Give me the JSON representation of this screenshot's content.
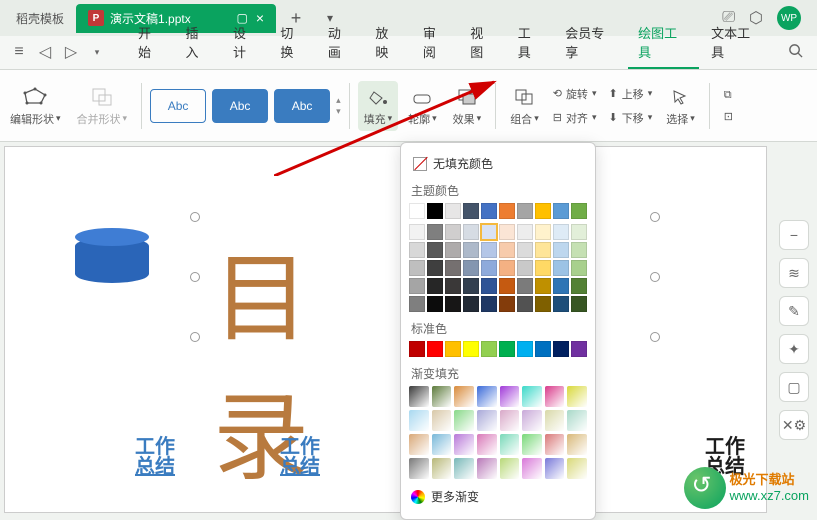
{
  "tabs": {
    "template_tab": "稻壳模板",
    "active_tab": "演示文稿1.pptx",
    "active_file_badge": "P"
  },
  "avatar_text": "WP",
  "menu": {
    "items": [
      "开始",
      "插入",
      "设计",
      "切换",
      "动画",
      "放映",
      "审阅",
      "视图",
      "工具",
      "会员专享",
      "绘图工具",
      "文本工具"
    ],
    "active_index": 10
  },
  "toolbar": {
    "edit_shape": "编辑形状",
    "merge_shape": "合并形状",
    "abc_text": "Abc",
    "fill": "填充",
    "outline": "轮廓",
    "effect": "效果",
    "combine": "组合",
    "rotate": "旋转",
    "align": "对齐",
    "move_up": "上移",
    "move_down": "下移",
    "select": "选择"
  },
  "color_panel": {
    "no_fill": "无填充颜色",
    "theme_colors": "主题颜色",
    "standard_colors": "标准色",
    "gradient_fill": "渐变填充",
    "more_gradient": "更多渐变",
    "theme_row0": [
      "#ffffff",
      "#000000",
      "#e7e6e6",
      "#44546a",
      "#4472c4",
      "#ed7d31",
      "#a5a5a5",
      "#ffc000",
      "#5b9bd5",
      "#70ad47"
    ],
    "theme_shades": [
      [
        "#f2f2f2",
        "#7f7f7f",
        "#d0cece",
        "#d6dce4",
        "#d9e2f3",
        "#fbe5d5",
        "#ededed",
        "#fff2cc",
        "#deebf6",
        "#e2efd9"
      ],
      [
        "#d8d8d8",
        "#595959",
        "#aeabab",
        "#adb9ca",
        "#b4c6e7",
        "#f7cbac",
        "#dbdbdb",
        "#fee599",
        "#bdd7ee",
        "#c5e0b3"
      ],
      [
        "#bfbfbf",
        "#3f3f3f",
        "#757070",
        "#8496b0",
        "#8eaadb",
        "#f4b183",
        "#c9c9c9",
        "#ffd965",
        "#9cc3e5",
        "#a8d08d"
      ],
      [
        "#a5a5a5",
        "#262626",
        "#3a3838",
        "#323f4f",
        "#2f5496",
        "#c55a11",
        "#7b7b7b",
        "#bf9000",
        "#2e75b5",
        "#538135"
      ],
      [
        "#7f7f7f",
        "#0c0c0c",
        "#171616",
        "#222a35",
        "#1f3864",
        "#833c0b",
        "#525252",
        "#7f6000",
        "#1e4e79",
        "#375623"
      ]
    ],
    "standard_row": [
      "#c00000",
      "#ff0000",
      "#ffc000",
      "#ffff00",
      "#92d050",
      "#00b050",
      "#00b0f0",
      "#0070c0",
      "#002060",
      "#7030a0"
    ],
    "gradients": [
      [
        "#3a3a3a",
        "#5c7a3a",
        "#d88a3a",
        "#3a6ad8",
        "#a03ad8",
        "#3ad8c8",
        "#d83a8a",
        "#d8d83a"
      ],
      [
        "#a8d8f0",
        "#d8c8a8",
        "#88d888",
        "#a8a8d8",
        "#d8a8c8",
        "#c8a8d8",
        "#d8d8a8",
        "#a8d8c8"
      ],
      [
        "#d8a878",
        "#78b8d8",
        "#b878d8",
        "#d878b8",
        "#78d8b8",
        "#78d878",
        "#d87878",
        "#d8b878"
      ],
      [
        "#787878",
        "#b8b878",
        "#78b8b8",
        "#b878b8",
        "#b8d878",
        "#d878d8",
        "#7878d8",
        "#d8d878"
      ]
    ]
  },
  "canvas": {
    "selected_text_char1": "目",
    "selected_text_char2": "录",
    "work1": "工作",
    "summary1": "总结"
  },
  "watermark": {
    "line1": "极光下载站",
    "line2": "www.xz7.com"
  }
}
